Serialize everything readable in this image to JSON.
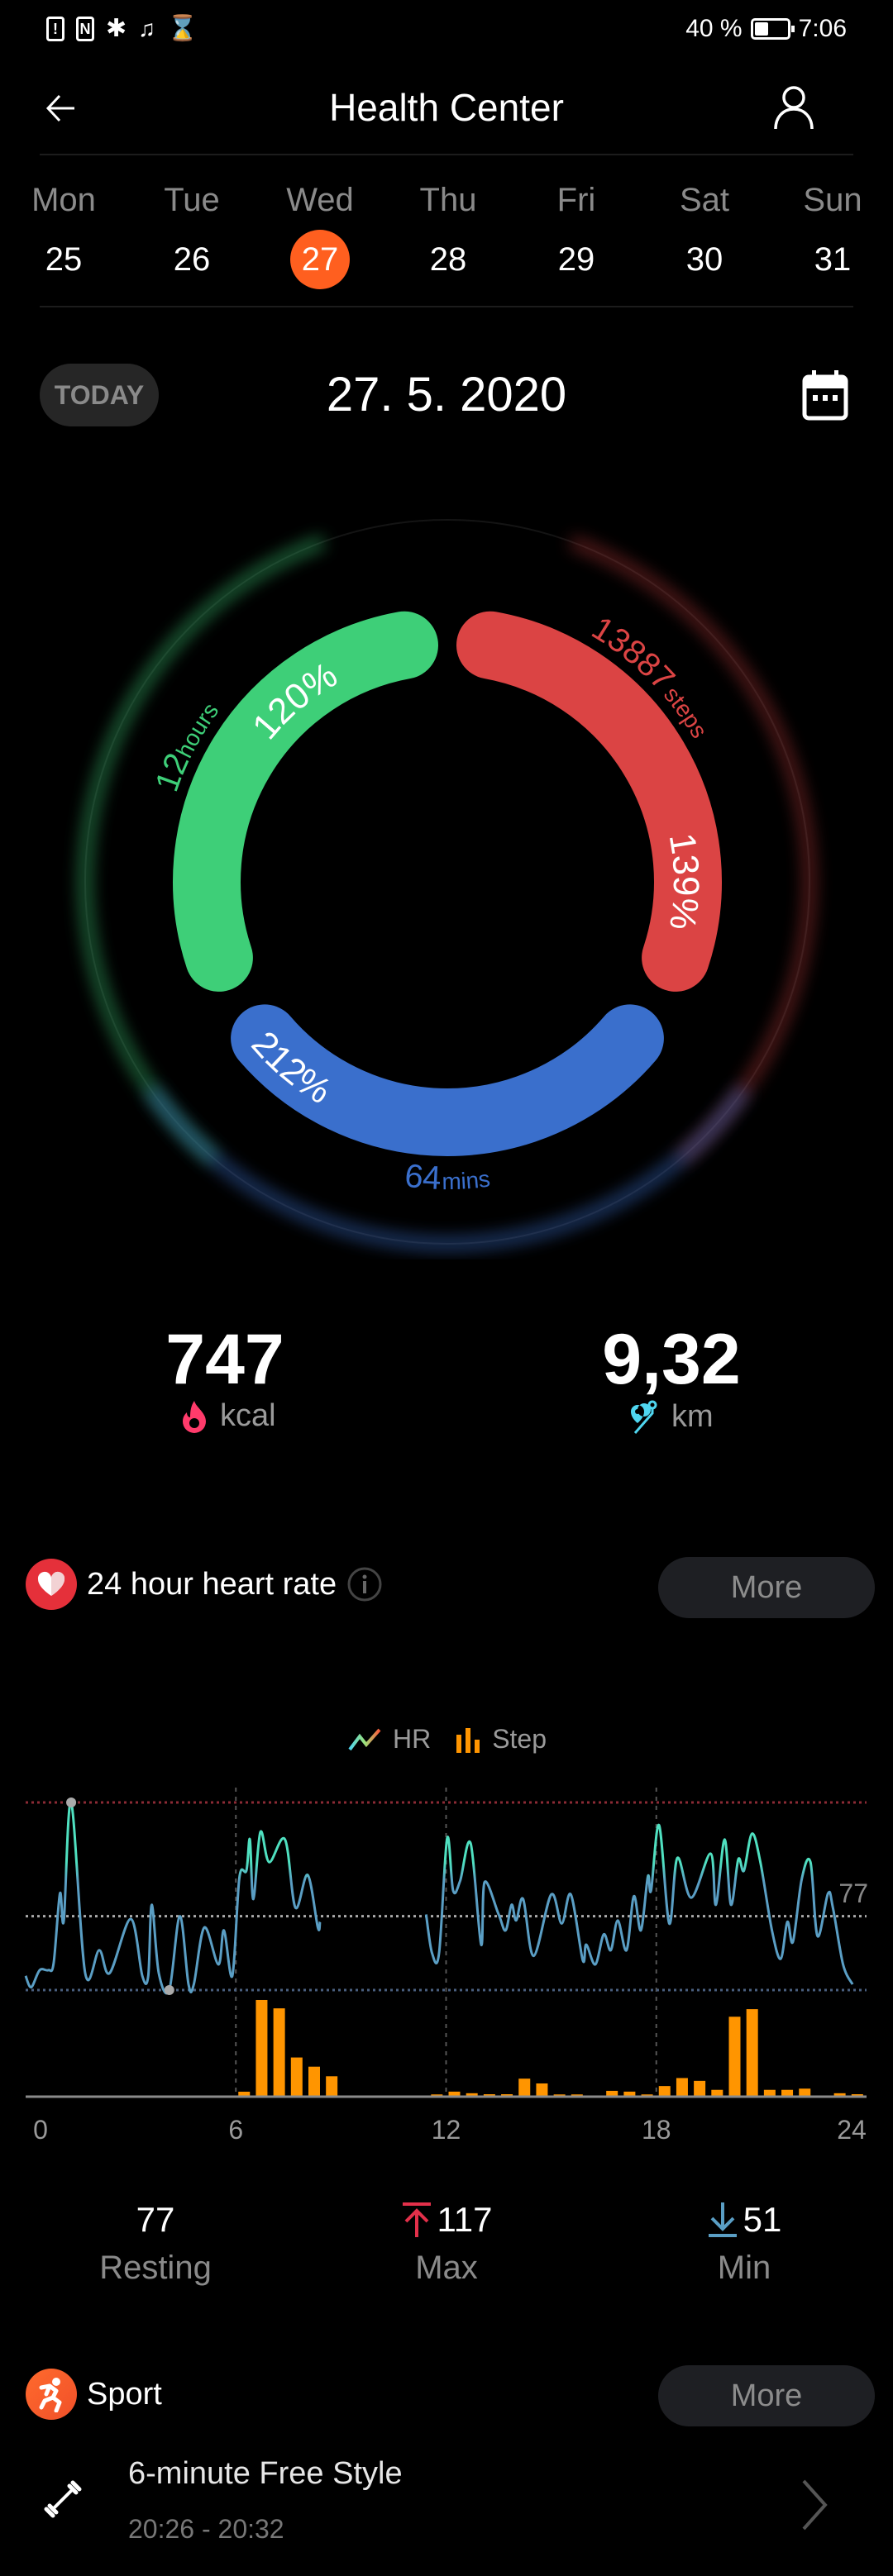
{
  "status_bar": {
    "battery": "40 %",
    "battery_level": 0.4,
    "time": "7:06",
    "icons": [
      "alert-icon",
      "nfc-icon",
      "bluetooth-icon",
      "bell-off-icon",
      "hourglass-icon"
    ]
  },
  "header": {
    "title": "Health Center",
    "back_icon": "arrow-left-icon",
    "profile_icon": "person-icon"
  },
  "week": {
    "days": [
      {
        "name": "Mon",
        "num": "25"
      },
      {
        "name": "Tue",
        "num": "26"
      },
      {
        "name": "Wed",
        "num": "27",
        "selected": true
      },
      {
        "name": "Thu",
        "num": "28"
      },
      {
        "name": "Fri",
        "num": "29"
      },
      {
        "name": "Sat",
        "num": "30"
      },
      {
        "name": "Sun",
        "num": "31"
      }
    ],
    "selected_color": "#ff5f1f"
  },
  "date_row": {
    "today_label": "TODAY",
    "date": "27. 5. 2020",
    "calendar_icon": "calendar-icon"
  },
  "rings": {
    "stand": {
      "percent": "120%",
      "value": "12",
      "unit": "hours",
      "color": "#3ecf78"
    },
    "steps": {
      "percent": "139%",
      "value": "13887",
      "unit": "steps",
      "color": "#db4444"
    },
    "exercise": {
      "percent": "212%",
      "value": "64",
      "unit": "mins",
      "color": "#3a6fcc"
    }
  },
  "summary": {
    "calories": {
      "value": "747",
      "unit": "kcal",
      "icon": "flame-icon",
      "color": "#ff3b6b"
    },
    "distance": {
      "value": "9,32",
      "unit": "km",
      "icon": "route-pin-icon",
      "color": "#4fd6f0"
    }
  },
  "heart_rate": {
    "title": "24 hour heart rate",
    "more_label": "More",
    "legend": {
      "hr": "HR",
      "step": "Step"
    },
    "stats": {
      "resting": "77",
      "resting_label": "Resting",
      "max": "117",
      "max_label": "Max",
      "min": "51",
      "min_label": "Min"
    }
  },
  "chart_data": {
    "type": "line",
    "x_ticks": [
      "0",
      "6",
      "12",
      "18",
      "24"
    ],
    "xlim": [
      0,
      24
    ],
    "hr_ylim": [
      51,
      117
    ],
    "reference_lines": {
      "max": 117,
      "resting": 77,
      "min": 51
    },
    "resting_label": "77",
    "series": [
      {
        "name": "HR",
        "type": "line",
        "colors": [
          "#5a9ec4",
          "#4fe0c0"
        ],
        "segments": [
          [
            [
              0,
              56
            ],
            [
              0.16,
              52
            ],
            [
              0.4,
              58
            ],
            [
              0.65,
              58
            ],
            [
              0.8,
              60.5
            ],
            [
              0.98,
              85
            ],
            [
              1.09,
              75.5
            ],
            [
              1.3,
              117
            ],
            [
              1.7,
              57
            ],
            [
              2.1,
              65
            ],
            [
              2.4,
              57
            ],
            [
              3.0,
              76
            ],
            [
              3.33,
              56
            ],
            [
              3.5,
              56
            ],
            [
              3.6,
              81
            ],
            [
              3.8,
              57
            ],
            [
              4.1,
              51
            ],
            [
              4.4,
              77
            ],
            [
              4.65,
              53
            ],
            [
              4.8,
              53
            ],
            [
              5.1,
              73
            ],
            [
              5.5,
              60
            ],
            [
              5.66,
              72
            ],
            [
              5.9,
              56
            ],
            [
              6.1,
              90.5
            ],
            [
              6.3,
              93
            ],
            [
              6.4,
              104
            ],
            [
              6.5,
              83
            ],
            [
              6.7,
              106.6
            ],
            [
              6.95,
              96
            ],
            [
              7.4,
              104
            ],
            [
              7.7,
              80
            ],
            [
              8.05,
              91.5
            ],
            [
              8.34,
              73
            ],
            [
              8.4,
              75
            ]
          ],
          [
            [
              11.43,
              77.6
            ],
            [
              11.6,
              64
            ],
            [
              11.8,
              64
            ],
            [
              12.03,
              104.4
            ],
            [
              12.2,
              86
            ],
            [
              12.4,
              89.4
            ],
            [
              12.7,
              102.6
            ],
            [
              13.0,
              67
            ],
            [
              13.1,
              89
            ],
            [
              13.5,
              77.6
            ],
            [
              13.7,
              72
            ],
            [
              13.87,
              81
            ],
            [
              14.0,
              75.5
            ],
            [
              14.2,
              83
            ],
            [
              14.5,
              63
            ],
            [
              15.0,
              84.6
            ],
            [
              15.3,
              74.4
            ],
            [
              15.56,
              84.6
            ],
            [
              15.9,
              61.5
            ],
            [
              16.0,
              67
            ],
            [
              16.26,
              60
            ],
            [
              16.5,
              70.6
            ],
            [
              16.7,
              65
            ],
            [
              16.9,
              75.5
            ],
            [
              17.15,
              65
            ],
            [
              17.36,
              84
            ],
            [
              17.56,
              72
            ],
            [
              17.76,
              91
            ],
            [
              17.85,
              86
            ],
            [
              18.08,
              109
            ],
            [
              18.37,
              74.4
            ],
            [
              18.6,
              97.5
            ],
            [
              19.0,
              83.5
            ],
            [
              19.55,
              99
            ],
            [
              19.7,
              81
            ],
            [
              19.95,
              104
            ],
            [
              20.13,
              81
            ],
            [
              20.34,
              97
            ],
            [
              20.5,
              93
            ],
            [
              20.73,
              106
            ],
            [
              20.97,
              96
            ],
            [
              21.3,
              72
            ],
            [
              21.55,
              62
            ],
            [
              21.74,
              75
            ],
            [
              21.9,
              68
            ],
            [
              22.15,
              90
            ],
            [
              22.4,
              96
            ],
            [
              22.6,
              70
            ],
            [
              22.9,
              85
            ],
            [
              23.04,
              80
            ],
            [
              23.33,
              60
            ],
            [
              23.6,
              53
            ]
          ]
        ],
        "max_point": [
          1.3,
          117
        ],
        "min_point": [
          4.1,
          51
        ]
      },
      {
        "name": "Step",
        "type": "bar",
        "color": "#ff9500",
        "bin_hours": 0.5,
        "ymax": 2400,
        "points": [
          [
            6.0,
            93
          ],
          [
            6.5,
            2390
          ],
          [
            7.0,
            2180
          ],
          [
            7.5,
            950
          ],
          [
            8.0,
            720
          ],
          [
            8.5,
            480
          ],
          [
            11.5,
            25
          ],
          [
            12.0,
            95
          ],
          [
            12.5,
            55
          ],
          [
            13.0,
            30
          ],
          [
            13.5,
            30
          ],
          [
            14.0,
            420
          ],
          [
            14.5,
            300
          ],
          [
            15.0,
            25
          ],
          [
            15.5,
            25
          ],
          [
            16.5,
            115
          ],
          [
            17.0,
            95
          ],
          [
            17.5,
            25
          ],
          [
            18.0,
            235
          ],
          [
            18.5,
            435
          ],
          [
            19.0,
            365
          ],
          [
            19.5,
            140
          ],
          [
            20.0,
            1970
          ],
          [
            20.5,
            2160
          ],
          [
            21.0,
            140
          ],
          [
            21.5,
            140
          ],
          [
            22.0,
            170
          ],
          [
            23.0,
            55
          ],
          [
            23.5,
            30
          ]
        ]
      }
    ],
    "grid": "vertical dashed at 6, 12, 18"
  },
  "sport": {
    "title": "Sport",
    "more_label": "More",
    "items": [
      {
        "name": "6-minute Free Style",
        "time": "20:26 - 20:32",
        "icon": "barbell-icon"
      }
    ]
  }
}
